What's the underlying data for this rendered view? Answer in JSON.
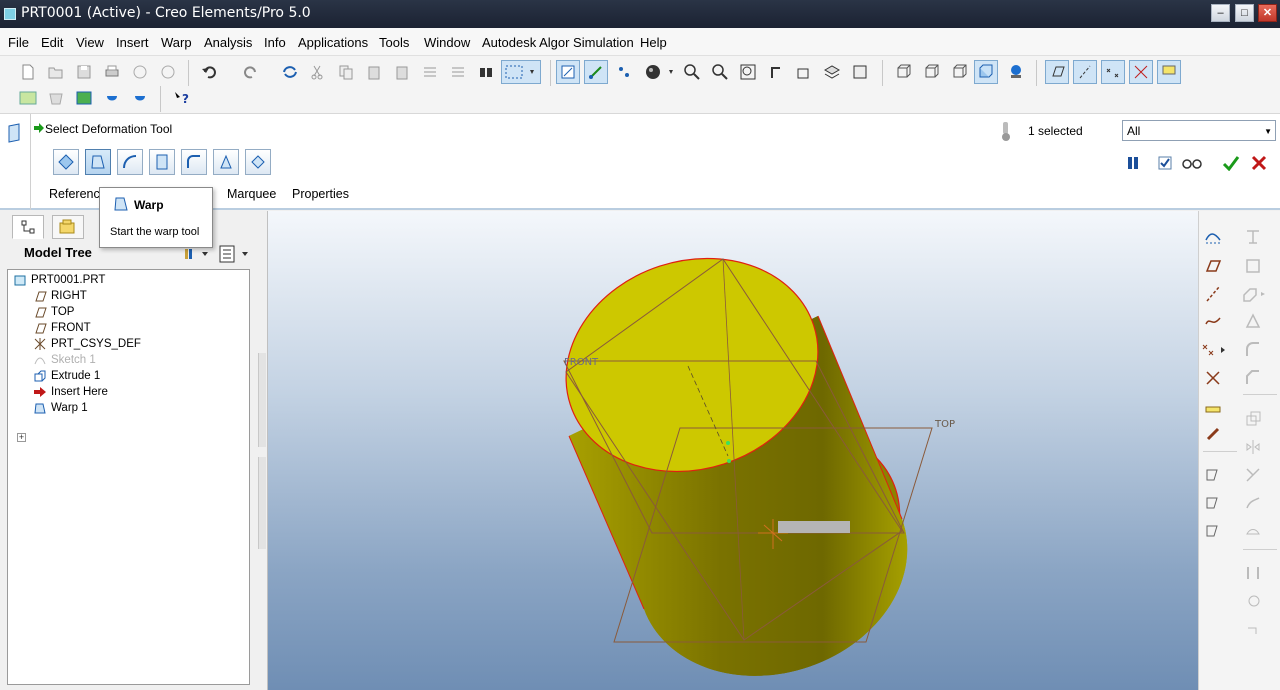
{
  "window": {
    "title": "PRT0001 (Active) - Creo Elements/Pro 5.0",
    "minimize": "‒",
    "maximize": "□",
    "close": "✕"
  },
  "menu": [
    "File",
    "Edit",
    "View",
    "Insert",
    "Warp",
    "Analysis",
    "Info",
    "Applications",
    "Tools",
    "Window",
    "Autodesk Algor Simulation",
    "Help"
  ],
  "dashboard": {
    "message": "Select Deformation Tool",
    "selection_status": "1 selected",
    "filter_value": "All",
    "tabs": [
      "Referenc",
      "Marquee",
      "Properties"
    ]
  },
  "tooltip": {
    "title": "Warp",
    "description": "Start the warp tool"
  },
  "model_tree": {
    "title": "Model Tree",
    "nodes": [
      {
        "label": "PRT0001.PRT"
      },
      {
        "label": "RIGHT"
      },
      {
        "label": "TOP"
      },
      {
        "label": "FRONT"
      },
      {
        "label": "PRT_CSYS_DEF"
      },
      {
        "label": "Sketch 1"
      },
      {
        "label": "Extrude 1"
      },
      {
        "label": "Insert Here"
      },
      {
        "label": "Warp 1"
      }
    ]
  },
  "viewport": {
    "datum_front": "FRONT",
    "datum_top": "TOP",
    "model_color": "#c8c400",
    "edge_color": "#e02010",
    "datum_color": "#8a5a3a"
  }
}
